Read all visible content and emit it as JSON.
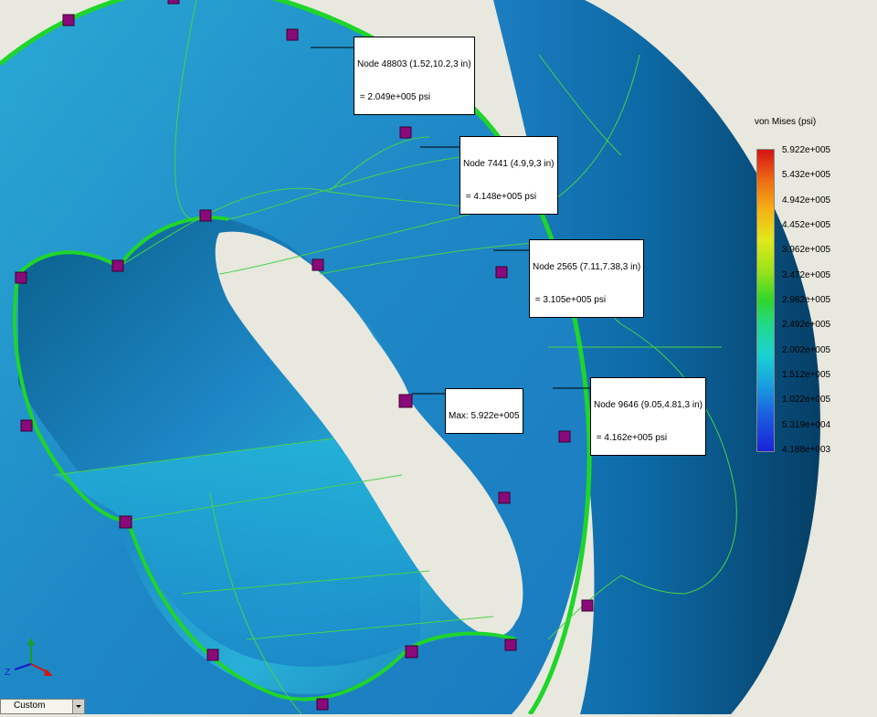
{
  "legend": {
    "title": "von Mises (psi)",
    "labels": [
      "5.922e+005",
      "5.432e+005",
      "4.942e+005",
      "4.452e+005",
      "3.962e+005",
      "3.472e+005",
      "2.982e+005",
      "2.492e+005",
      "2.002e+005",
      "1.512e+005",
      "1.022e+005",
      "5.319e+004",
      "4.188e+003"
    ]
  },
  "callouts": {
    "node48803_line1": "Node 48803 (1.52,10.2,3 in)",
    "node48803_line2": " = 2.049e+005 psi",
    "node7441_line1": "Node 7441 (4.9,9,3 in)",
    "node7441_line2": " = 4.148e+005 psi",
    "node2565_line1": "Node 2565 (7.11,7.38,3 in)",
    "node2565_line2": " = 3.105e+005 psi",
    "node9646_line1": "Node 9646 (9.05,4.81,3 in)",
    "node9646_line2": " = 4.162e+005 psi",
    "max_label": "Max: 5.922e+005"
  },
  "triad": {
    "z_label": "Z"
  },
  "view_combo": {
    "value": "Custom"
  },
  "colors": {
    "background": "#e8e8de",
    "mesh_edge": "#1fd52a",
    "marker": "#8a0a7a"
  }
}
